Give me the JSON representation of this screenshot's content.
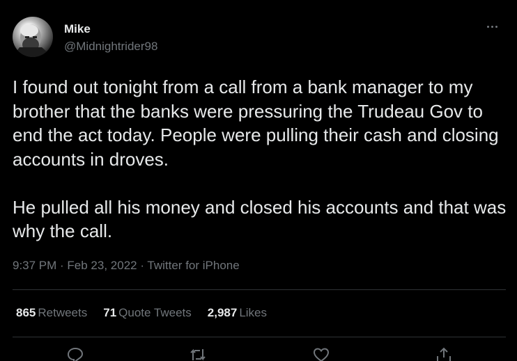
{
  "author": {
    "display_name": "Mike",
    "handle": "@Midnightrider98"
  },
  "tweet": {
    "text": "I found out tonight from a call from a bank manager to my brother that the banks were pressuring the Trudeau Gov to end the act today. People were pulling their cash and closing accounts in droves.\n\nHe pulled all his money and closed his accounts and that was why the call."
  },
  "meta": {
    "time_date_source": "9:37 PM · Feb 23, 2022 · Twitter for iPhone"
  },
  "stats": {
    "retweets": {
      "count": "865",
      "label": "Retweets"
    },
    "quotes": {
      "count": "71",
      "label": "Quote Tweets"
    },
    "likes": {
      "count": "2,987",
      "label": "Likes"
    }
  },
  "actions": [
    "reply-icon",
    "retweet-icon",
    "like-icon",
    "share-icon"
  ],
  "colors": {
    "background": "#000000",
    "primary_text": "#e7e9ea",
    "secondary_text": "#71767b",
    "divider": "#2f3336"
  }
}
